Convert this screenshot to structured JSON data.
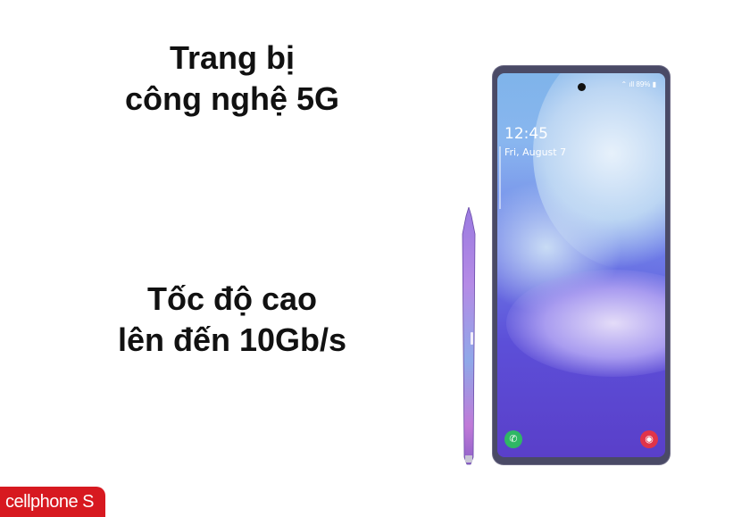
{
  "headline_5g": {
    "line1": "Trang bị",
    "line2": "công nghệ 5G"
  },
  "headline_speed": {
    "line1": "Tốc độ cao",
    "line2": "lên đến 10Gb/s"
  },
  "phone": {
    "status": "⌃ ıll 89% ▮",
    "time": "12:45",
    "date": "Fri, August 7",
    "call_icon": "phone-icon",
    "camera_icon": "camera-icon"
  },
  "logo": {
    "text": "cellphone S"
  },
  "colors": {
    "logo_red": "#d71920",
    "headline_text": "#111111",
    "phone_frame": "#4a4a66"
  }
}
